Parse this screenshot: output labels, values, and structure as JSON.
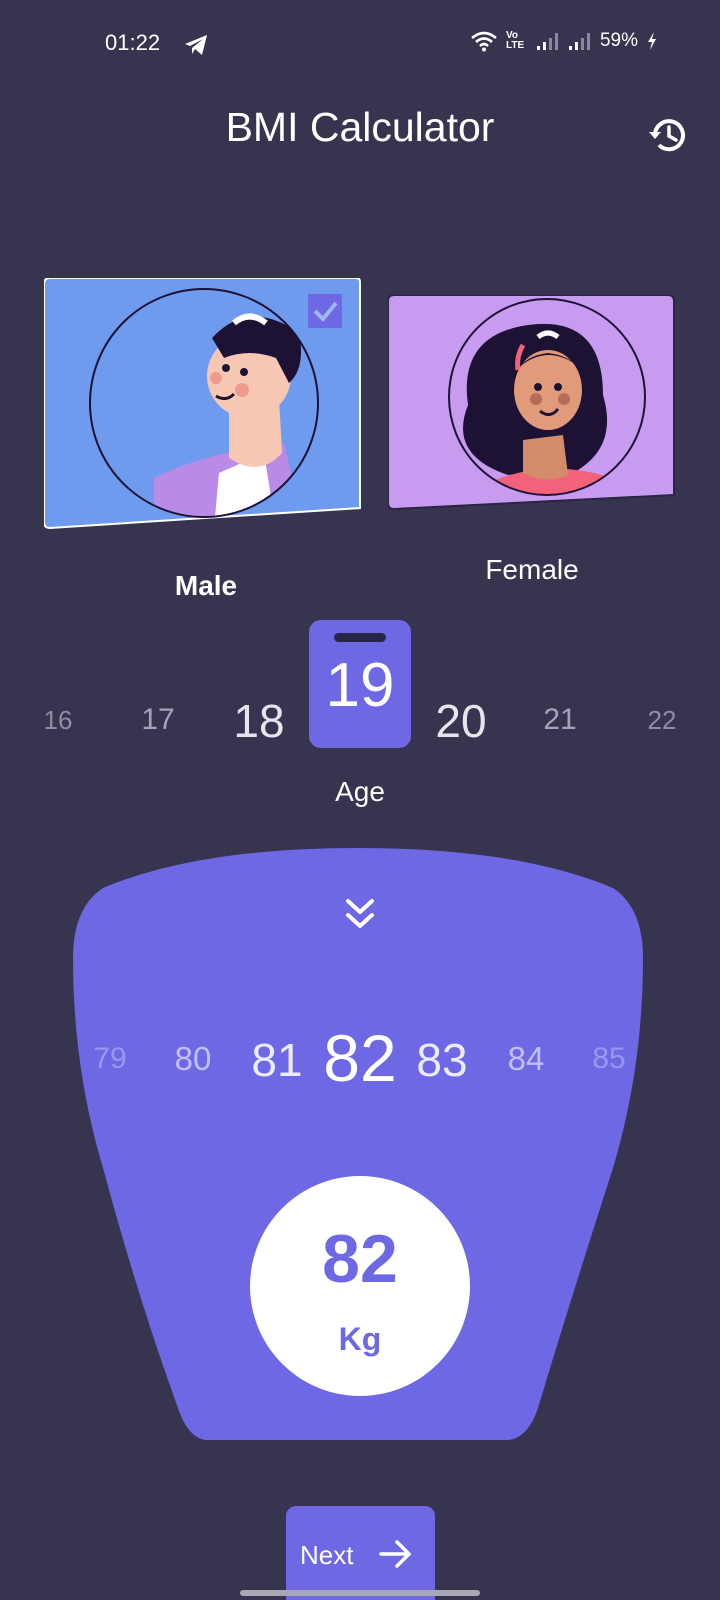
{
  "status_bar": {
    "time": "01:22",
    "battery": "59%",
    "icons": [
      "telegram-icon",
      "wifi-icon",
      "volte-icon",
      "signal-icon",
      "signal-icon",
      "charging-icon"
    ],
    "volte_text": "Vo LTE"
  },
  "header": {
    "title": "BMI Calculator",
    "history_icon": "history-icon"
  },
  "gender": {
    "options": [
      {
        "label": "Male",
        "selected": true
      },
      {
        "label": "Female",
        "selected": false
      }
    ]
  },
  "age": {
    "values": [
      "16",
      "17",
      "18",
      "19",
      "20",
      "21",
      "22"
    ],
    "selected": "19",
    "label": "Age"
  },
  "weight": {
    "values": [
      "79",
      "80",
      "81",
      "82",
      "83",
      "84",
      "85"
    ],
    "selected": "82",
    "display_value": "82",
    "unit": "Kg",
    "chevron_icon": "double-chevron-down-icon"
  },
  "next_button": {
    "label": "Next",
    "icon": "arrow-right-icon"
  },
  "colors": {
    "background": "#373450",
    "accent": "#6E68E4",
    "male_card": "#6F9BEF",
    "female_card": "#C79CF0"
  }
}
